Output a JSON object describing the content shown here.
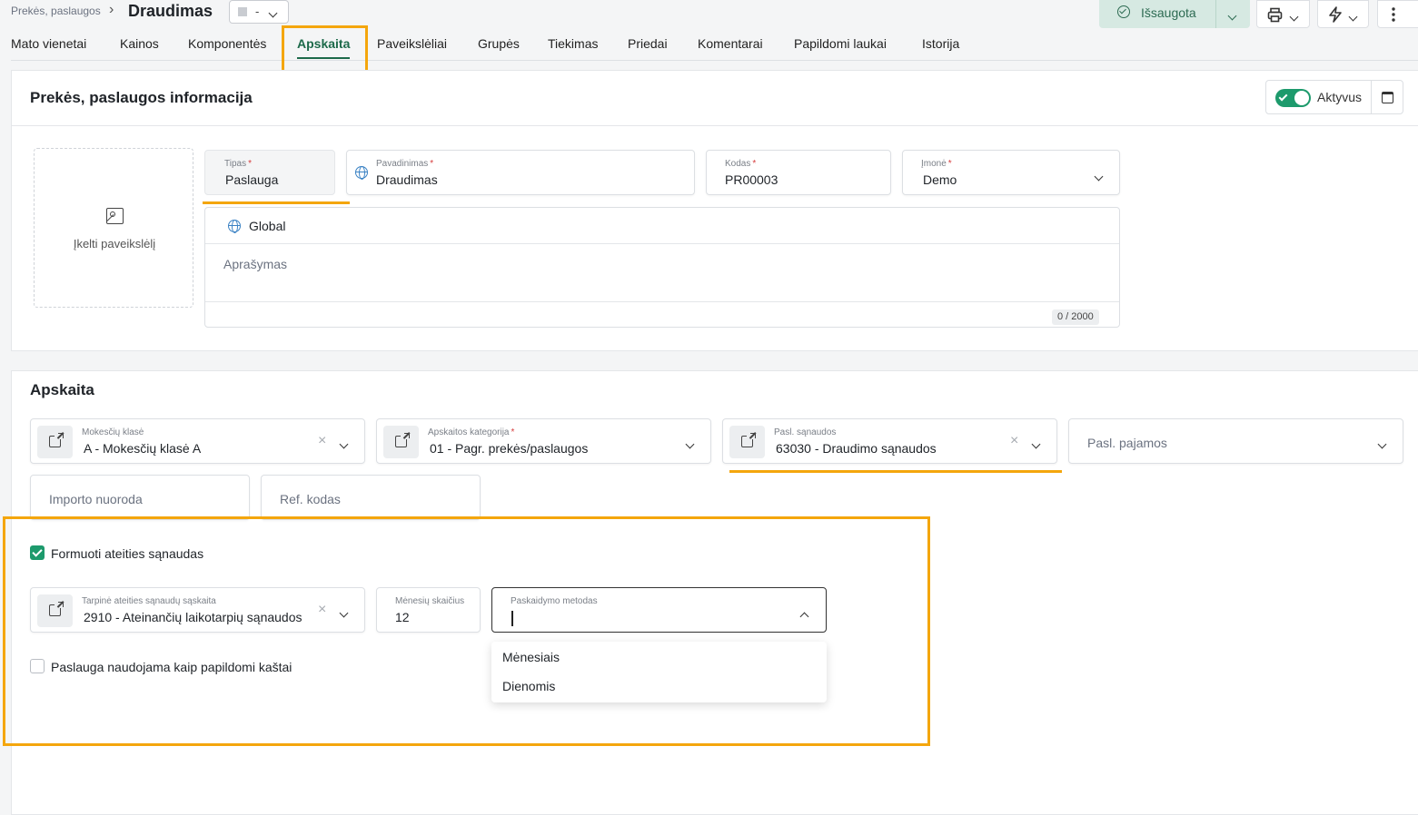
{
  "header": {
    "breadcrumb": "Prekės, paslaugos",
    "breadcrumb_sep": "›",
    "title": "Draudimas",
    "status_value": "-",
    "saved_label": "Išsaugota"
  },
  "tabs": [
    {
      "label": "Mato vienetai"
    },
    {
      "label": "Kainos"
    },
    {
      "label": "Komponentės"
    },
    {
      "label": "Apskaita"
    },
    {
      "label": "Paveikslėliai"
    },
    {
      "label": "Grupės"
    },
    {
      "label": "Tiekimas"
    },
    {
      "label": "Priedai"
    },
    {
      "label": "Komentarai"
    },
    {
      "label": "Papildomi laukai"
    },
    {
      "label": "Istorija"
    }
  ],
  "active_tab": "Apskaita",
  "info": {
    "title": "Prekės, paslaugos informacija",
    "active_label": "Aktyvus",
    "active": true,
    "upload_label": "Įkelti paveikslėlį",
    "tipas": {
      "label": "Tipas",
      "value": "Paslauga"
    },
    "pavadinimas": {
      "label": "Pavadinimas",
      "value": "Draudimas"
    },
    "kodas": {
      "label": "Kodas",
      "value": "PR00003"
    },
    "imone": {
      "label": "Įmonė",
      "value": "Demo"
    },
    "lang_label": "Global",
    "desc_placeholder": "Aprašymas",
    "desc_counter": "0 / 2000"
  },
  "apskaita": {
    "title": "Apskaita",
    "mokesciu": {
      "label": "Mokesčių klasė",
      "value": "A - Mokesčių klasė A"
    },
    "kategorija": {
      "label": "Apskaitos kategorija",
      "value": "01 - Pagr. prekės/paslaugos"
    },
    "sanaudos": {
      "label": "Pasl. sąnaudos",
      "value": "63030 - Draudimo sąnaudos"
    },
    "pajamos": {
      "placeholder": "Pasl. pajamos"
    },
    "importo": {
      "placeholder": "Importo nuoroda"
    },
    "ref": {
      "placeholder": "Ref. kodas"
    },
    "formuoti": {
      "label": "Formuoti ateities sąnaudas",
      "checked": true
    },
    "tarpine": {
      "label": "Tarpinė ateities sąnaudų sąskaita",
      "value": "2910 - Ateinančių laikotarpių sąnaudos"
    },
    "menesiu": {
      "label": "Mėnesių skaičius",
      "value": "12"
    },
    "paskaidymo": {
      "label": "Paskaidymo metodas",
      "value": ""
    },
    "menu_options": [
      "Mėnesiais",
      "Dienomis"
    ],
    "papildomi": {
      "label": "Paslauga naudojama kaip papildomi kaštai",
      "checked": false
    }
  },
  "colors": {
    "accent": "#1d9a6c",
    "highlight": "#f4a60d",
    "tab_active": "#1d6a4a"
  }
}
